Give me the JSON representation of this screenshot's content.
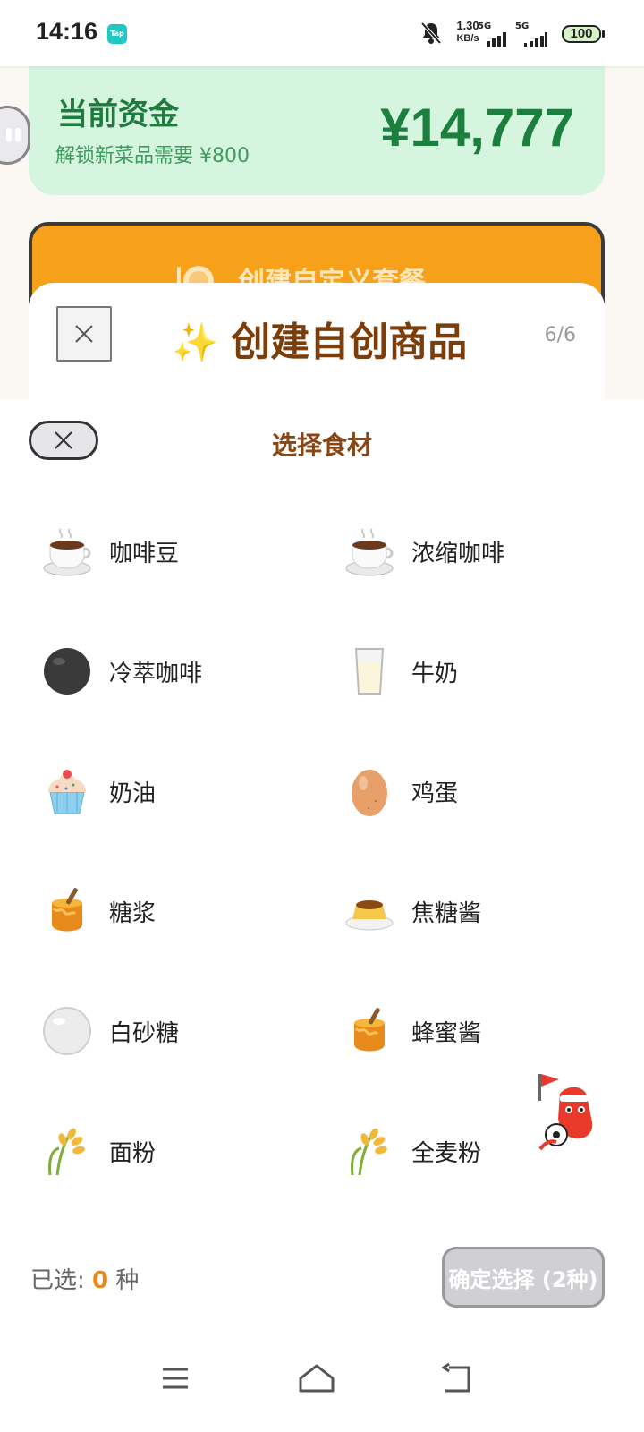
{
  "status_bar": {
    "time": "14:16",
    "app_badge": "Tap",
    "net_speed_value": "1.30",
    "net_speed_unit": "KB/s",
    "signal_1": "5G",
    "signal_2": "5G",
    "battery": "100"
  },
  "funds": {
    "title": "当前资金",
    "subtitle": "解锁新菜品需要 ¥800",
    "amount": "¥14,777"
  },
  "banner": {
    "label": "创建自定义套餐"
  },
  "modal": {
    "title": "创建自创商品",
    "step": "6/6"
  },
  "picker": {
    "title": "选择食材",
    "ingredients": [
      {
        "name": "咖啡豆",
        "icon": "coffee-cup-icon"
      },
      {
        "name": "浓缩咖啡",
        "icon": "coffee-cup-icon"
      },
      {
        "name": "冷萃咖啡",
        "icon": "black-circle-icon"
      },
      {
        "name": "牛奶",
        "icon": "milk-glass-icon"
      },
      {
        "name": "奶油",
        "icon": "cupcake-icon"
      },
      {
        "name": "鸡蛋",
        "icon": "egg-icon"
      },
      {
        "name": "糖浆",
        "icon": "honey-pot-icon"
      },
      {
        "name": "焦糖酱",
        "icon": "custard-icon"
      },
      {
        "name": "白砂糖",
        "icon": "white-circle-icon"
      },
      {
        "name": "蜂蜜酱",
        "icon": "honey-pot-icon"
      },
      {
        "name": "面粉",
        "icon": "wheat-icon"
      },
      {
        "name": "全麦粉",
        "icon": "wheat-icon"
      }
    ]
  },
  "footer": {
    "selected_prefix": "已选: ",
    "selected_count": "0",
    "selected_suffix": " 种",
    "confirm_label": "确定选择 (2种)"
  },
  "colors": {
    "funds_bg": "#d5f5df",
    "funds_text": "#1b7f3d",
    "banner_orange": "#f7a11a",
    "title_brown": "#7b3d0a",
    "count_orange": "#e58a1f"
  }
}
